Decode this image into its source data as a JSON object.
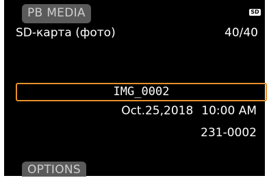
{
  "header": {
    "tab_label": "PB MEDIA",
    "title": "SD-карта (фото)",
    "media_badge": "SD",
    "counter": "40/40"
  },
  "file": {
    "name": "IMG_0002",
    "date": "Oct.25,2018",
    "time": "10:00 AM",
    "folder_file_number": "231-0002"
  },
  "footer": {
    "options_label": "OPTIONS"
  },
  "colors": {
    "accent": "#e8902a",
    "background": "#000000",
    "tab": "#5a5a5a"
  }
}
